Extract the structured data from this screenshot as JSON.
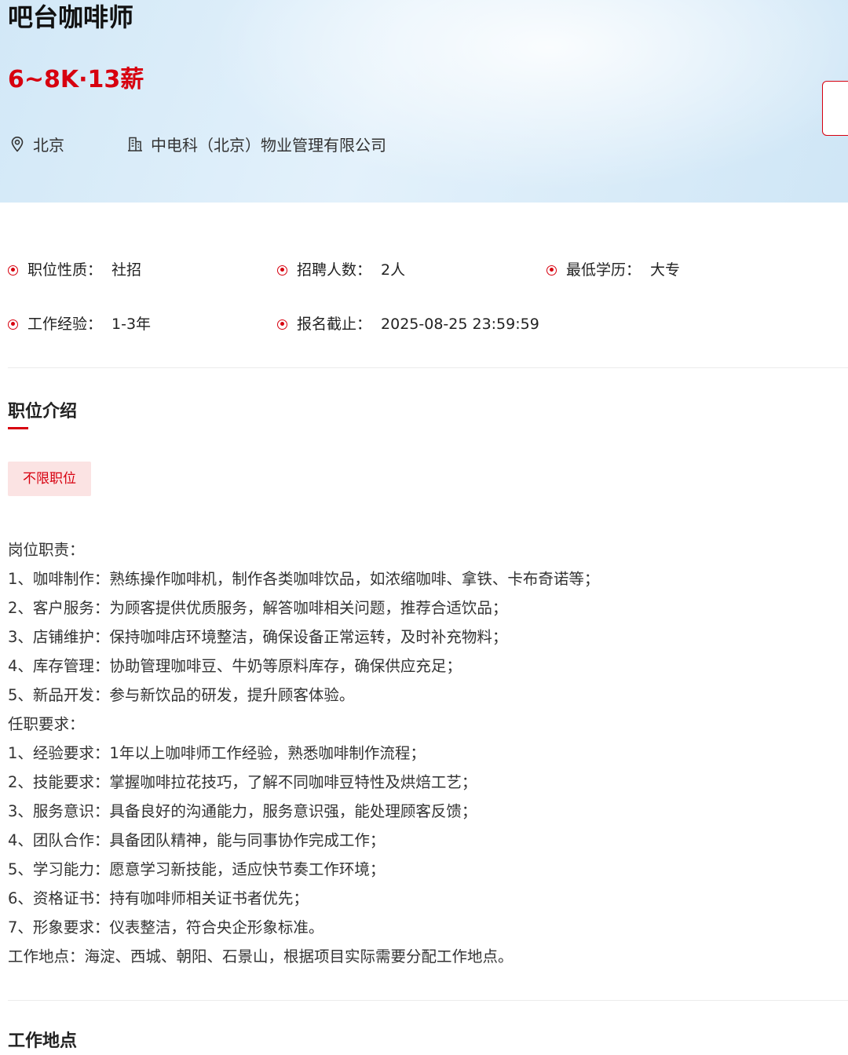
{
  "job": {
    "title": "吧台咖啡师",
    "salary": "6~8K·13薪",
    "location": "北京",
    "company": "中电科（北京）物业管理有限公司"
  },
  "info": {
    "nature_label": "职位性质：",
    "nature_value": "社招",
    "headcount_label": "招聘人数：",
    "headcount_value": "2人",
    "education_label": "最低学历：",
    "education_value": "大专",
    "experience_label": "工作经验：",
    "experience_value": "1-3年",
    "deadline_label": "报名截止：",
    "deadline_value": "2025-08-25 23:59:59"
  },
  "intro": {
    "title": "职位介绍",
    "tag": "不限职位",
    "lines": [
      "岗位职责：",
      "1、咖啡制作：熟练操作咖啡机，制作各类咖啡饮品，如浓缩咖啡、拿铁、卡布奇诺等；",
      "2、客户服务：为顾客提供优质服务，解答咖啡相关问题，推荐合适饮品；",
      "3、店铺维护：保持咖啡店环境整洁，确保设备正常运转，及时补充物料；",
      "4、库存管理：协助管理咖啡豆、牛奶等原料库存，确保供应充足；",
      "5、新品开发：参与新饮品的研发，提升顾客体验。",
      "任职要求：",
      "1、经验要求：1年以上咖啡师工作经验，熟悉咖啡制作流程；",
      "2、技能要求：掌握咖啡拉花技巧，了解不同咖啡豆特性及烘焙工艺；",
      "3、服务意识：具备良好的沟通能力，服务意识强，能处理顾客反馈；",
      "4、团队合作：具备团队精神，能与同事协作完成工作；",
      "5、学习能力：愿意学习新技能，适应快节奏工作环境；",
      "6、资格证书：持有咖啡师相关证书者优先；",
      "7、形象要求：仪表整洁，符合央企形象标准。",
      "工作地点：海淀、西城、朝阳、石景山，根据项目实际需要分配工作地点。"
    ]
  },
  "location_section": {
    "title": "工作地点"
  },
  "colors": {
    "accent": "#d7000f",
    "tag_bg": "#fbe3e3",
    "header_bg": "#d9ecf8"
  }
}
